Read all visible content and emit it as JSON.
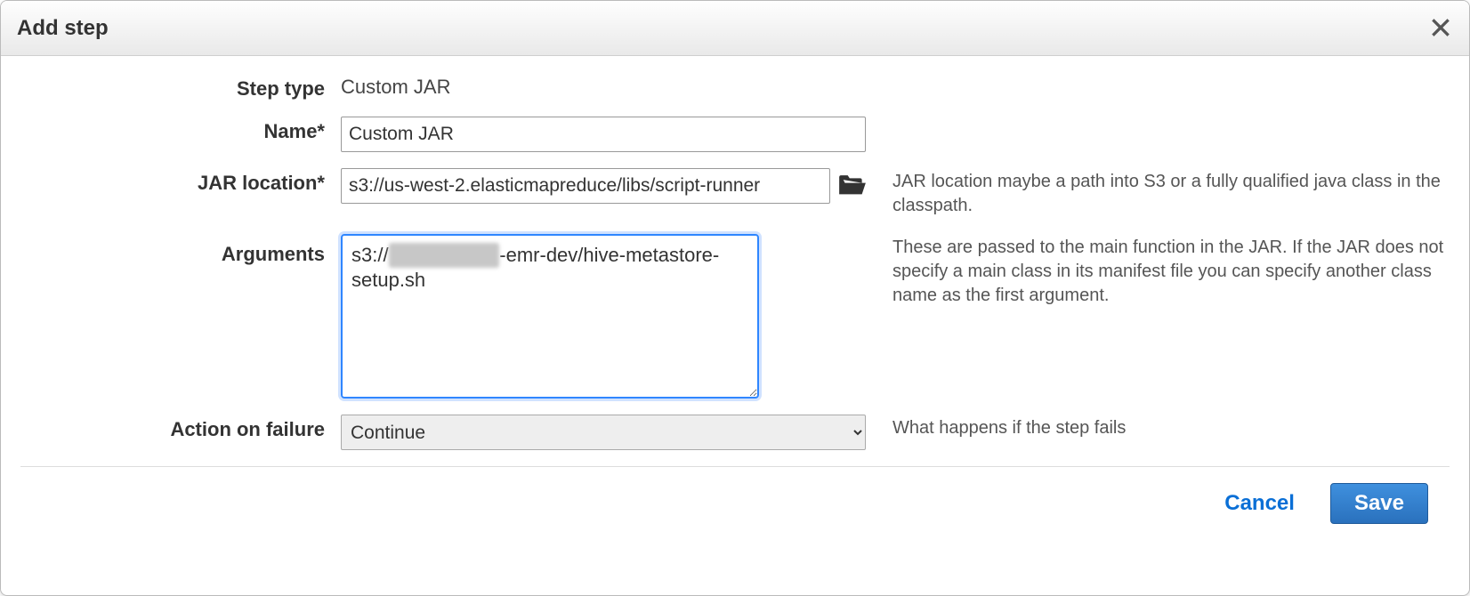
{
  "dialog": {
    "title": "Add step",
    "labels": {
      "step_type": "Step type",
      "name": "Name*",
      "jar_location": "JAR location*",
      "arguments": "Arguments",
      "action_on_failure": "Action on failure"
    },
    "values": {
      "step_type": "Custom JAR",
      "name": "Custom JAR",
      "jar_location": "s3://us-west-2.elasticmapreduce/libs/script-runner",
      "arguments_prefix": "s3://",
      "arguments_redacted": "████████",
      "arguments_suffix": "-emr-dev/hive-metastore-setup.sh",
      "action_on_failure": "Continue"
    },
    "help": {
      "jar_location": "JAR location maybe a path into S3 or a fully qualified java class in the classpath.",
      "arguments": "These are passed to the main function in the JAR. If the JAR does not specify a main class in its manifest file you can specify another class name as the first argument.",
      "action_on_failure": "What happens if the step fails"
    },
    "buttons": {
      "cancel": "Cancel",
      "save": "Save"
    }
  }
}
